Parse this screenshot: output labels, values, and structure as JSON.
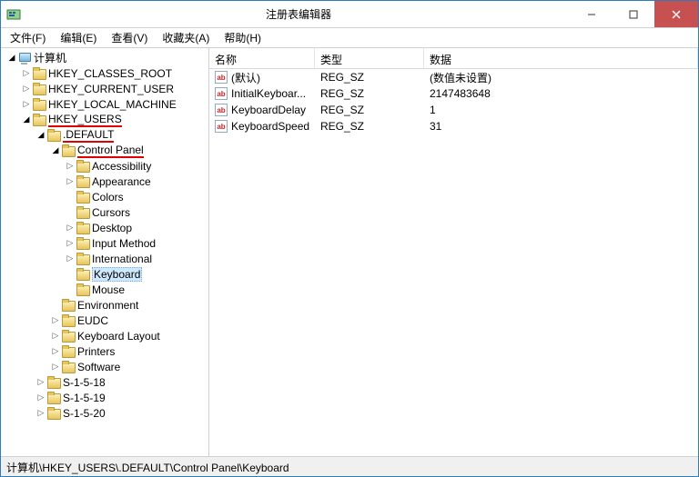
{
  "window": {
    "title": "注册表编辑器"
  },
  "menu": {
    "file": "文件(F)",
    "edit": "编辑(E)",
    "view": "查看(V)",
    "favorites": "收藏夹(A)",
    "help": "帮助(H)"
  },
  "tree": {
    "root": "计算机",
    "hkcr": "HKEY_CLASSES_ROOT",
    "hkcu": "HKEY_CURRENT_USER",
    "hklm": "HKEY_LOCAL_MACHINE",
    "hku": "HKEY_USERS",
    "default": ".DEFAULT",
    "control_panel": "Control Panel",
    "accessibility": "Accessibility",
    "appearance": "Appearance",
    "colors": "Colors",
    "cursors": "Cursors",
    "desktop": "Desktop",
    "input_method": "Input Method",
    "international": "International",
    "keyboard": "Keyboard",
    "mouse": "Mouse",
    "environment": "Environment",
    "eudc": "EUDC",
    "keyboard_layout": "Keyboard Layout",
    "printers": "Printers",
    "software": "Software",
    "s1518": "S-1-5-18",
    "s1519": "S-1-5-19",
    "s1520": "S-1-5-20"
  },
  "columns": {
    "name": "名称",
    "type": "类型",
    "data": "数据"
  },
  "rows": [
    {
      "name": "(默认)",
      "type": "REG_SZ",
      "data": "(数值未设置)"
    },
    {
      "name": "InitialKeyboar...",
      "type": "REG_SZ",
      "data": "2147483648"
    },
    {
      "name": "KeyboardDelay",
      "type": "REG_SZ",
      "data": "1"
    },
    {
      "name": "KeyboardSpeed",
      "type": "REG_SZ",
      "data": "31"
    }
  ],
  "statusbar": {
    "path": "计算机\\HKEY_USERS\\.DEFAULT\\Control Panel\\Keyboard"
  },
  "icon_label": "ab"
}
